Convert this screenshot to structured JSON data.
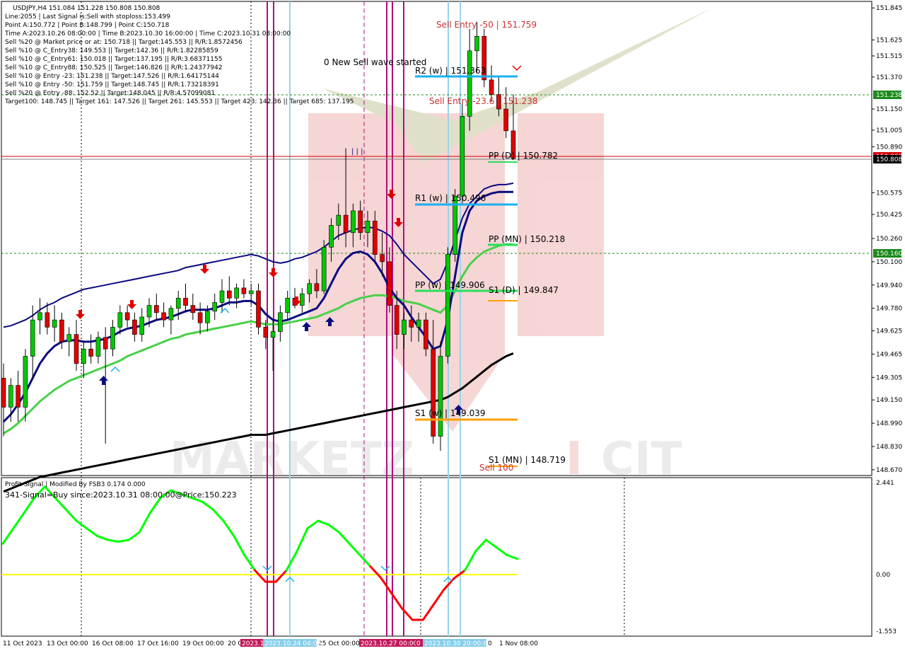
{
  "header": {
    "symbol": "USDJPY,H4  151.084 151.228 150.808 150.808",
    "lines": [
      "Line:2055 | Last Signal is:Sell with stoploss:153.499",
      "Point A:150.772 | Point B:148.799 | Point C:150.718",
      "Time A:2023.10.26 08:00:00 | Time B:2023.10.30 16:00:00 | Time C:2023.10.31 08:00:00",
      "Sell %20 @ Market price or at: 150.718 || Target:145.553 || R/R:1.8572456",
      "Sell %10 @ C_Entry38: 149.553 || Target:142.36 || R/R:1.82285859",
      "Sell %10 @ C_Entry61: 150.018 || Target:137.195 || R/R:3.68371155",
      "Sell %10 @ C_Entry88: 150.525 || Target:146.826 || R/R:1.24377942",
      "Sell %10 @ Entry -23: 151.238 || Target:147.526 || R/R:1.64175144",
      "Sell %10 @ Entry -50: 151.759 || Target:148.745 || R/R:1.73218391",
      "Sell %20 @ Entry -88: 152.52 || Target:148.045 || R/R:4.57099081",
      "Target100: 148.745 || Target 161: 147.526 || Target 261: 145.553 || Target 423: 142.36 || Target 685: 137.195"
    ]
  },
  "annotations": {
    "wave": "0 New Sell wave started",
    "sell_entry_50": "Sell Entry -50 | 151.759",
    "sell_entry_23": "Sell Entry -23.6 | 151.238",
    "sell_100": "Sell 100",
    "r2w": "R2 (w) | 151.363",
    "r1w": "R1 (w) | 150.496",
    "ppw": "PP (w) | 149.906",
    "s1w": "S1 (w) | 149.039",
    "ppd": "PP (D) | 150.782",
    "s1d": "S1 (D) | 149.847",
    "ppmn": "PP (MN) | 150.218",
    "s1mn": "S1 (MN) | 148.719",
    "bars_marker": "| | |"
  },
  "price_axis": {
    "ticks": [
      "151.845",
      "151.625",
      "151.515",
      "151.370",
      "151.150",
      "151.005",
      "150.890",
      "150.575",
      "150.425",
      "150.260",
      "150.100",
      "149.940",
      "149.780",
      "149.625",
      "149.465",
      "149.305",
      "149.150",
      "148.990",
      "148.830",
      "148.670"
    ],
    "tick_values": [
      151.845,
      151.625,
      151.515,
      151.37,
      151.15,
      151.005,
      150.89,
      150.575,
      150.425,
      150.26,
      150.1,
      149.94,
      149.78,
      149.625,
      149.465,
      149.305,
      149.15,
      148.99,
      148.83,
      148.67
    ],
    "label_green_top": "151.238",
    "label_red": "150.880",
    "label_current": "150.808",
    "label_green_bottom": "150.160"
  },
  "indicator": {
    "title": "Profit-Signal | Modified By FSB3 0.174 0.000",
    "signal": "341-Signal=Buy since:2023.10.31 08:00:00@Price:150.223",
    "axis": [
      "2.441",
      "0.00",
      "-1.553"
    ]
  },
  "time_axis": {
    "labels": [
      "11 Oct 2023",
      "13 Oct 00:00",
      "16 Oct 08:00",
      "17 Oct 16:00",
      "19 Oct 00:00",
      "20 O",
      "25 Oct 00:00",
      "1 Nov 08:00"
    ],
    "boxes": [
      {
        "text": "2023.1",
        "color": "#c2185b"
      },
      {
        "text": "2023.10.24 04:00",
        "color": "#87ceeb"
      },
      {
        "text": "2023.10.27 00:00",
        "color": "#c2185b"
      },
      {
        "text": "0",
        "color": "#c2185b"
      },
      {
        "text": "2023.10.30 20:00:00",
        "color": "#87ceeb"
      },
      {
        "text": "0",
        "color": "#ffffff"
      }
    ]
  },
  "colors": {
    "up": "#00c800",
    "down": "#e00000",
    "ma_blue": "#0a0a80",
    "ma_green": "#48d048",
    "ma_black": "#000000",
    "magenta": "#b0107a",
    "lightblue": "#9ad4e6",
    "pivot_blue": "#1ab0f0",
    "pivot_green": "#28e05a",
    "pivot_orange": "#ffa000",
    "osc_green": "#00ff00",
    "osc_red": "#ff0000",
    "osc_zero": "#ffff00"
  },
  "chart_data": {
    "type": "candlestick",
    "symbol": "USDJPY",
    "timeframe": "H4",
    "ylim": [
      148.64,
      151.88
    ],
    "ohlc": [
      [
        149.3,
        149.4,
        148.9,
        149.1
      ],
      [
        149.1,
        149.3,
        149.0,
        149.25
      ],
      [
        149.25,
        149.35,
        149.0,
        149.1
      ],
      [
        149.1,
        149.5,
        149.0,
        149.45
      ],
      [
        149.45,
        149.8,
        149.3,
        149.7
      ],
      [
        149.7,
        149.85,
        149.6,
        149.75
      ],
      [
        149.75,
        149.82,
        149.6,
        149.65
      ],
      [
        149.65,
        149.8,
        149.55,
        149.7
      ],
      [
        149.7,
        149.75,
        149.5,
        149.55
      ],
      [
        149.55,
        149.65,
        149.45,
        149.6
      ],
      [
        149.6,
        149.7,
        149.35,
        149.4
      ],
      [
        149.4,
        149.55,
        149.3,
        149.5
      ],
      [
        149.5,
        149.6,
        149.4,
        149.45
      ],
      [
        149.45,
        149.62,
        149.4,
        149.58
      ],
      [
        149.58,
        149.65,
        148.85,
        149.5
      ],
      [
        149.5,
        149.7,
        149.45,
        149.65
      ],
      [
        149.65,
        149.8,
        149.6,
        149.75
      ],
      [
        149.75,
        149.8,
        149.65,
        149.7
      ],
      [
        149.7,
        149.75,
        149.55,
        149.6
      ],
      [
        149.6,
        149.78,
        149.55,
        149.72
      ],
      [
        149.72,
        149.85,
        149.65,
        149.8
      ],
      [
        149.8,
        149.88,
        149.7,
        149.75
      ],
      [
        149.75,
        149.82,
        149.65,
        149.7
      ],
      [
        149.7,
        149.8,
        149.6,
        149.78
      ],
      [
        149.78,
        149.9,
        149.7,
        149.85
      ],
      [
        149.85,
        149.95,
        149.75,
        149.8
      ],
      [
        149.8,
        149.88,
        149.7,
        149.75
      ],
      [
        149.75,
        149.82,
        149.6,
        149.68
      ],
      [
        149.68,
        149.8,
        149.62,
        149.76
      ],
      [
        149.76,
        149.88,
        149.7,
        149.82
      ],
      [
        149.82,
        149.98,
        149.75,
        149.9
      ],
      [
        149.9,
        150.0,
        149.8,
        149.85
      ],
      [
        149.85,
        149.95,
        149.78,
        149.92
      ],
      [
        149.92,
        149.98,
        149.85,
        149.88
      ],
      [
        149.88,
        149.95,
        149.8,
        149.9
      ],
      [
        149.9,
        149.95,
        149.6,
        149.65
      ],
      [
        149.65,
        149.7,
        149.5,
        149.58
      ],
      [
        149.58,
        149.7,
        149.35,
        149.62
      ],
      [
        149.62,
        149.8,
        149.55,
        149.75
      ],
      [
        149.75,
        149.9,
        149.7,
        149.85
      ],
      [
        149.85,
        149.92,
        149.78,
        149.8
      ],
      [
        149.8,
        149.92,
        149.75,
        149.88
      ],
      [
        149.88,
        149.98,
        149.82,
        149.95
      ],
      [
        149.95,
        150.05,
        149.85,
        149.9
      ],
      [
        149.9,
        150.25,
        149.88,
        150.2
      ],
      [
        150.2,
        150.4,
        150.1,
        150.35
      ],
      [
        150.35,
        150.5,
        150.25,
        150.42
      ],
      [
        150.42,
        150.88,
        150.2,
        150.3
      ],
      [
        150.3,
        150.5,
        150.2,
        150.45
      ],
      [
        150.45,
        150.52,
        150.25,
        150.3
      ],
      [
        150.3,
        150.45,
        150.2,
        150.38
      ],
      [
        150.38,
        150.45,
        150.1,
        150.15
      ],
      [
        150.15,
        150.3,
        150.0,
        150.1
      ],
      [
        150.1,
        150.2,
        149.75,
        149.8
      ],
      [
        149.8,
        149.9,
        149.5,
        149.6
      ],
      [
        149.6,
        149.75,
        149.5,
        149.7
      ],
      [
        149.7,
        149.8,
        149.55,
        149.65
      ],
      [
        149.65,
        149.75,
        149.55,
        149.7
      ],
      [
        149.7,
        149.75,
        149.45,
        149.5
      ],
      [
        149.5,
        149.7,
        148.85,
        148.9
      ],
      [
        148.9,
        149.55,
        148.8,
        149.45
      ],
      [
        149.45,
        150.2,
        149.4,
        150.15
      ],
      [
        150.15,
        150.6,
        150.1,
        150.55
      ],
      [
        150.55,
        151.2,
        150.5,
        151.1
      ],
      [
        151.1,
        151.7,
        151.0,
        151.55
      ],
      [
        151.55,
        151.75,
        151.4,
        151.65
      ],
      [
        151.65,
        151.7,
        151.3,
        151.35
      ],
      [
        151.35,
        151.45,
        151.2,
        151.25
      ],
      [
        151.25,
        151.38,
        151.1,
        151.15
      ],
      [
        151.15,
        151.3,
        150.95,
        151.0
      ],
      [
        151.0,
        151.25,
        150.8,
        150.81
      ]
    ],
    "series": [
      {
        "name": "ma_upper",
        "values": [
          149.65,
          149.66,
          149.68,
          149.7,
          149.73,
          149.77,
          149.8,
          149.82,
          149.85,
          149.87,
          149.89,
          149.91,
          149.92,
          149.93,
          149.94,
          149.95,
          149.96,
          149.97,
          149.98,
          149.99,
          150.0,
          150.01,
          150.02,
          150.03,
          150.04,
          150.06,
          150.07,
          150.08,
          150.09,
          150.1,
          150.11,
          150.12,
          150.13,
          150.14,
          150.15,
          150.14,
          150.12,
          150.1,
          150.09,
          150.1,
          150.12,
          150.13,
          150.15,
          150.17,
          150.2,
          150.24,
          150.28,
          150.3,
          150.32,
          150.33,
          150.34,
          150.33,
          150.31,
          150.28,
          150.22,
          150.15,
          150.1,
          150.05,
          150.0,
          149.95,
          149.98,
          150.1,
          150.25,
          150.4,
          150.5,
          150.55,
          150.6,
          150.62,
          150.63,
          150.63,
          150.64
        ]
      },
      {
        "name": "ma_mid",
        "values": [
          149.0,
          149.05,
          149.12,
          149.2,
          149.3,
          149.4,
          149.47,
          149.52,
          149.55,
          149.56,
          149.56,
          149.55,
          149.55,
          149.56,
          149.57,
          149.59,
          149.62,
          149.64,
          149.65,
          149.66,
          149.68,
          149.7,
          149.71,
          149.72,
          149.74,
          149.76,
          149.77,
          149.77,
          149.77,
          149.78,
          149.8,
          149.82,
          149.82,
          149.83,
          149.83,
          149.8,
          149.74,
          149.7,
          149.69,
          149.7,
          149.72,
          149.74,
          149.76,
          149.78,
          149.85,
          149.95,
          150.05,
          150.12,
          150.16,
          150.17,
          150.15,
          150.1,
          150.02,
          149.92,
          149.85,
          149.8,
          149.72,
          149.65,
          149.58,
          149.5,
          149.52,
          149.7,
          150.0,
          150.3,
          150.45,
          150.52,
          150.55,
          150.57,
          150.58,
          150.58,
          150.58
        ]
      },
      {
        "name": "ma_green",
        "values": [
          148.92,
          148.95,
          148.99,
          149.04,
          149.09,
          149.14,
          149.18,
          149.22,
          149.25,
          149.28,
          149.3,
          149.32,
          149.34,
          149.36,
          149.38,
          149.4,
          149.42,
          149.45,
          149.47,
          149.49,
          149.51,
          149.53,
          149.55,
          149.57,
          149.58,
          149.6,
          149.61,
          149.62,
          149.63,
          149.64,
          149.65,
          149.66,
          149.67,
          149.68,
          149.69,
          149.68,
          149.67,
          149.67,
          149.67,
          149.68,
          149.69,
          149.7,
          149.71,
          149.72,
          149.74,
          149.76,
          149.78,
          149.81,
          149.83,
          149.85,
          149.86,
          149.87,
          149.87,
          149.86,
          149.85,
          149.83,
          149.82,
          149.81,
          149.79,
          149.77,
          149.75,
          149.8,
          149.9,
          150.0,
          150.08,
          150.13,
          150.17,
          150.19,
          150.21,
          150.22,
          150.22
        ]
      },
      {
        "name": "ma_black",
        "values": [
          148.52,
          148.54,
          148.56,
          148.58,
          148.6,
          148.62,
          148.63,
          148.64,
          148.65,
          148.66,
          148.67,
          148.68,
          148.69,
          148.7,
          148.71,
          148.72,
          148.73,
          148.74,
          148.75,
          148.76,
          148.77,
          148.78,
          148.79,
          148.8,
          148.81,
          148.82,
          148.83,
          148.84,
          148.85,
          148.86,
          148.87,
          148.88,
          148.89,
          148.9,
          148.91,
          148.91,
          148.91,
          148.92,
          148.93,
          148.94,
          148.95,
          148.96,
          148.97,
          148.98,
          148.99,
          149.0,
          149.01,
          149.02,
          149.03,
          149.04,
          149.05,
          149.06,
          149.07,
          149.08,
          149.09,
          149.1,
          149.11,
          149.12,
          149.13,
          149.14,
          149.15,
          149.17,
          149.2,
          149.23,
          149.27,
          149.31,
          149.35,
          149.39,
          149.42,
          149.45,
          149.47
        ]
      }
    ],
    "oscillator": [
      0.8,
      1.2,
      1.6,
      2.0,
      2.3,
      2.0,
      1.7,
      1.4,
      1.2,
      1.0,
      0.9,
      0.85,
      0.9,
      1.1,
      1.6,
      2.0,
      2.2,
      2.1,
      2.0,
      1.9,
      1.7,
      1.4,
      1.0,
      0.5,
      0.1,
      -0.2,
      -0.2,
      0.1,
      0.6,
      1.2,
      1.4,
      1.3,
      1.1,
      0.8,
      0.5,
      0.2,
      -0.1,
      -0.5,
      -0.9,
      -1.2,
      -1.2,
      -0.8,
      -0.4,
      -0.1,
      0.1,
      0.6,
      0.9,
      0.7,
      0.5,
      0.4
    ]
  }
}
